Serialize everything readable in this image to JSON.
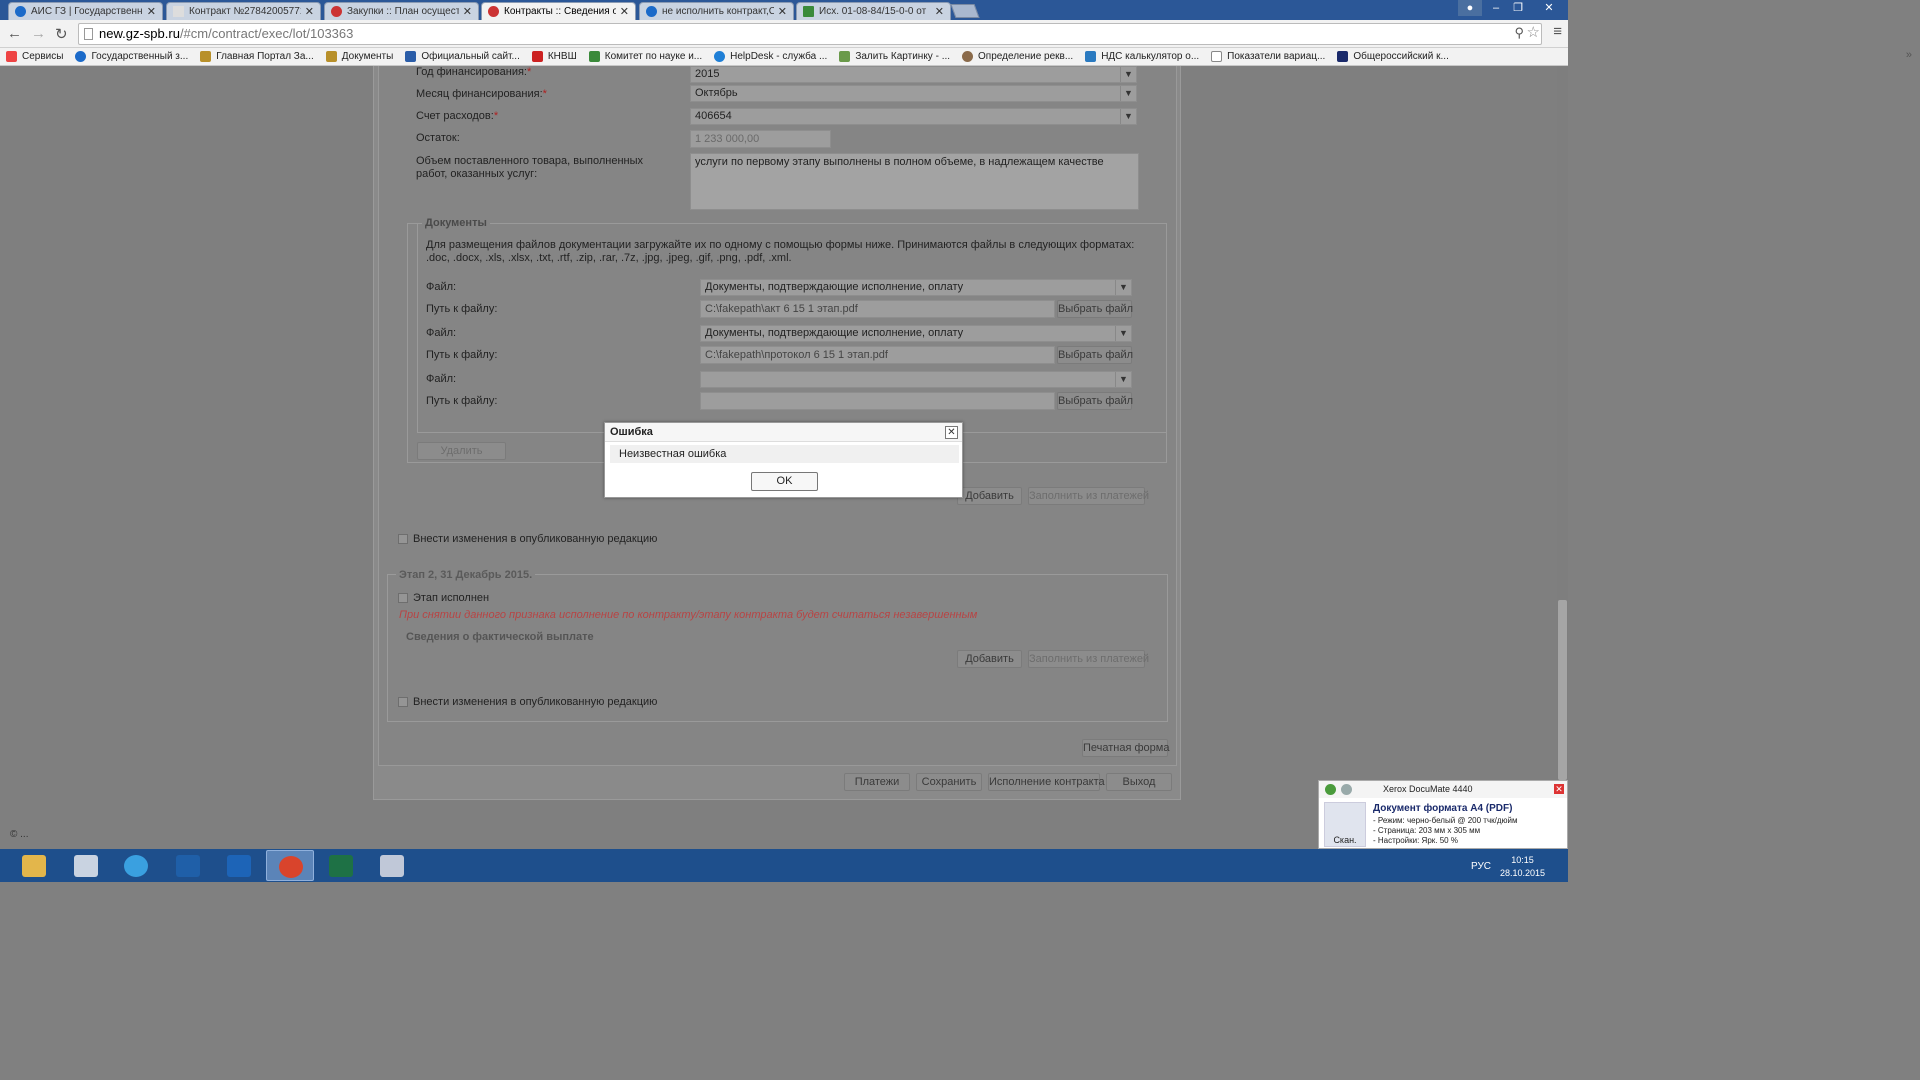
{
  "browser": {
    "tabs": [
      {
        "title": "АИС ГЗ | Государственны"
      },
      {
        "title": "Контракт №27842005771"
      },
      {
        "title": "Закупки :: План осущест"
      },
      {
        "title": "Контракты :: Сведения о"
      },
      {
        "title": "не исполнить контракт,С"
      },
      {
        "title": "Исх. 01-08-84/15-0-0 от"
      }
    ],
    "url_domain": "new.gz-spb.ru",
    "url_path": "/#cm/contract/exec/lot/103363",
    "bookmarks": [
      {
        "label": "Сервисы"
      },
      {
        "label": "Государственный з..."
      },
      {
        "label": "Главная Портал За..."
      },
      {
        "label": "Документы"
      },
      {
        "label": "Официальный сайт..."
      },
      {
        "label": "КНВШ"
      },
      {
        "label": "Комитет по науке и..."
      },
      {
        "label": "HelpDesk - служба ..."
      },
      {
        "label": "Залить Картинку - ..."
      },
      {
        "label": "Определение рекв..."
      },
      {
        "label": "НДС калькулятор о..."
      },
      {
        "label": "Показатели вариац..."
      },
      {
        "label": "Общероссийский к..."
      }
    ],
    "bookmarks_more": "»"
  },
  "form": {
    "year_label": "Год финансирования:",
    "year_value": "2015",
    "month_label": "Месяц финансирования:",
    "month_value": "Октябрь",
    "account_label": "Счет расходов:",
    "account_value": "406654",
    "remainder_label": "Остаток:",
    "remainder_value": "1 233 000,00",
    "volume_label": "Объем поставленного товара, выполненных работ, оказанных услуг:",
    "volume_value": "услуги по первому этапу выполнены в полном объеме,  в надлежащем качестве",
    "required_mark": "*"
  },
  "documents": {
    "legend": "Документы",
    "info": "Для размещения файлов документации загружайте их по одному с помощью формы ниже. Принимаются файлы в следующих форматах: .doc, .docx, .xls, .xlsx, .txt, .rtf, .zip, .rar, .7z, .jpg, .jpeg, .gif, .png, .pdf, .xml.",
    "file_label": "Файл:",
    "path_label": "Путь к файлу:",
    "choose_label": "Выбрать файл",
    "files": [
      {
        "type": "Документы, подтверждающие исполнение, оплату",
        "path": "C:\\fakepath\\акт 6 15  1 этап.pdf"
      },
      {
        "type": "Документы, подтверждающие исполнение, оплату",
        "path": "C:\\fakepath\\протокол 6 15 1 этап.pdf"
      },
      {
        "type": "",
        "path": ""
      }
    ],
    "delete_label": "Удалить"
  },
  "stage1": {
    "add_label": "Добавить",
    "fill_label": "Заполнить из платежей",
    "publish_label": "Внести изменения в опубликованную редакцию"
  },
  "stage2": {
    "title": "Этап 2, 31 Декабрь 2015.",
    "done_label": "Этап исполнен",
    "warning": "При снятии данного признака исполнение по контракту/этапу контракта будет считаться незавершенным",
    "payment_title": "Сведения о фактической выплате",
    "add_label": "Добавить",
    "fill_label": "Заполнить из платежей",
    "publish_label": "Внести изменения в опубликованную редакцию"
  },
  "bottom": {
    "print_label": "Печатная форма",
    "payments_label": "Платежи",
    "save_label": "Сохранить",
    "execution_label": "Исполнение контракта",
    "exit_label": "Выход"
  },
  "modal": {
    "title": "Ошибка",
    "message": "Неизвестная ошибка",
    "ok_label": "OK"
  },
  "footer": {
    "copyright": "© ..."
  },
  "xerox": {
    "header": "Xerox DocuMate 4440",
    "title": "Документ формата А4 (PDF)",
    "lines": [
      "- Режим: черно-белый @ 200 тчк/дюйм",
      "- Страница: 203 мм x 305 мм",
      "- Настройки: Ярк. 50 %"
    ],
    "scan_label": "Скан."
  },
  "taskbar": {
    "lang": "РУС",
    "time": "10:15",
    "date": "28.10.2015"
  }
}
